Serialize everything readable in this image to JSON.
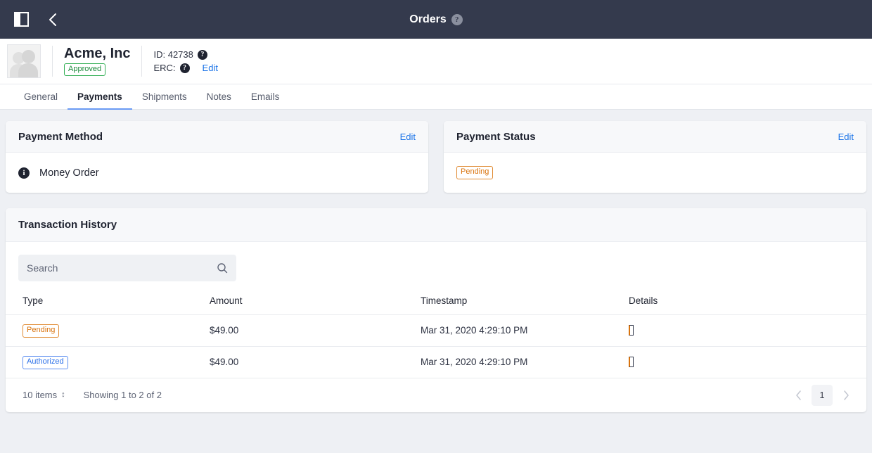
{
  "topbar": {
    "title": "Orders",
    "help_glyph": "?",
    "panel_toggle_name": "sidebar-toggle",
    "back_glyph": "‹"
  },
  "entity": {
    "name": "Acme, Inc",
    "status_badge": "Approved",
    "id_label": "ID: 42738",
    "erc_label": "ERC:",
    "help_glyph": "?",
    "edit_label": "Edit"
  },
  "tabs": [
    {
      "label": "General",
      "active": false
    },
    {
      "label": "Payments",
      "active": true
    },
    {
      "label": "Shipments",
      "active": false
    },
    {
      "label": "Notes",
      "active": false
    },
    {
      "label": "Emails",
      "active": false
    }
  ],
  "payment_method_card": {
    "title": "Payment Method",
    "edit_label": "Edit",
    "info_glyph": "i",
    "value": "Money Order"
  },
  "payment_status_card": {
    "title": "Payment Status",
    "edit_label": "Edit",
    "status": "Pending"
  },
  "transaction_history": {
    "title": "Transaction History",
    "search_placeholder": "Search",
    "search_value": "",
    "columns": [
      "Type",
      "Amount",
      "Timestamp",
      "Details"
    ],
    "rows": [
      {
        "type": "Pending",
        "type_style": "pending",
        "amount": "$49.00",
        "timestamp": "Mar 31, 2020 4:29:10 PM",
        "details_glyph": "▯"
      },
      {
        "type": "Authorized",
        "type_style": "authorized",
        "amount": "$49.00",
        "timestamp": "Mar 31, 2020 4:29:10 PM",
        "details_glyph": "▯"
      }
    ],
    "footer": {
      "items_per_page": "10 items",
      "items_caret": "↕",
      "showing": "Showing 1 to 2 of 2",
      "prev_glyph": "‹",
      "next_glyph": "›",
      "current_page": "1"
    }
  },
  "colors": {
    "topbar_bg": "#343a4d",
    "page_bg": "#eef0f4",
    "accent_link": "#1a73e8",
    "status_pending": "#d9730d",
    "status_authorized": "#2a6fe8",
    "status_approved": "#1b8a3b",
    "tab_active_underline": "#6a9bf4"
  }
}
